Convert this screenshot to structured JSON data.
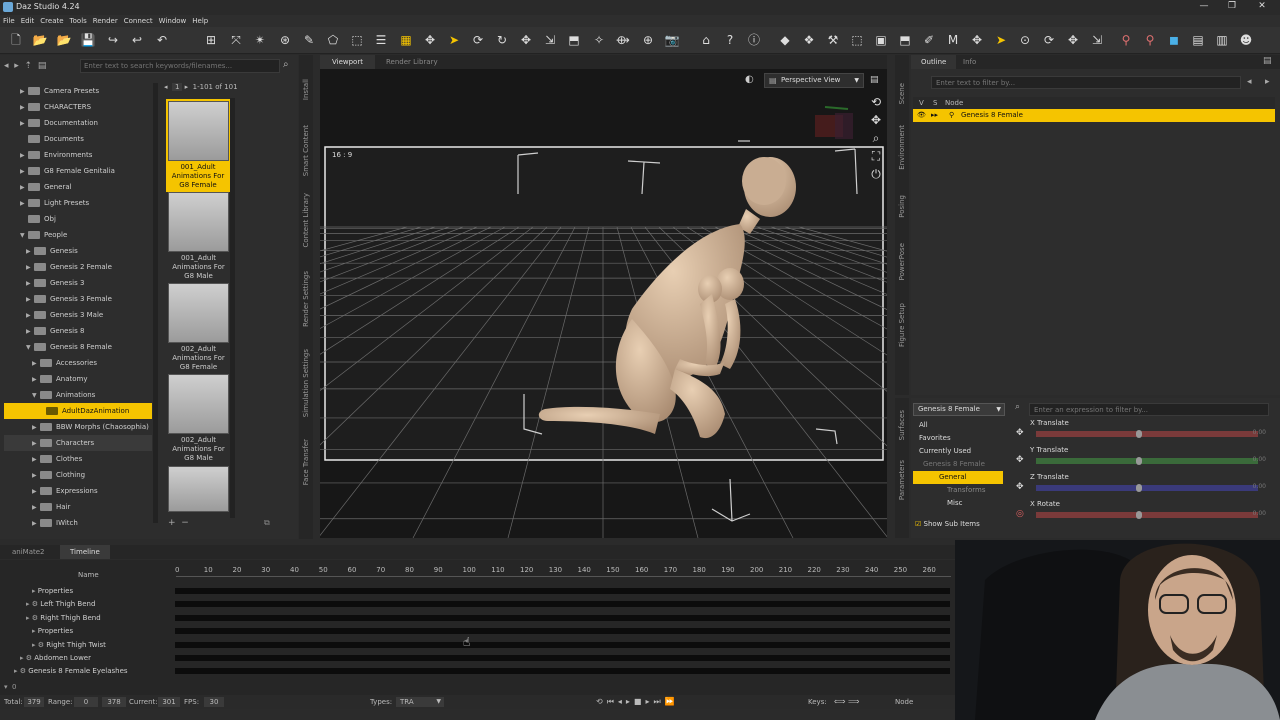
{
  "window": {
    "title": "Daz Studio 4.24",
    "controls": [
      "—",
      "❐",
      "✕"
    ]
  },
  "menu": [
    "File",
    "Edit",
    "Create",
    "Tools",
    "Render",
    "Connect",
    "Window",
    "Help"
  ],
  "content_library": {
    "search_placeholder": "Enter text to search keywords/filenames...",
    "page": "1",
    "range": "1-101 of 101",
    "tree": [
      {
        "label": "Camera Presets",
        "indent": 0,
        "state": "closed"
      },
      {
        "label": "CHARACTERS",
        "indent": 0,
        "state": "closed"
      },
      {
        "label": "Documentation",
        "indent": 0,
        "state": "closed"
      },
      {
        "label": "Documents",
        "indent": 0,
        "state": "none"
      },
      {
        "label": "Environments",
        "indent": 0,
        "state": "closed"
      },
      {
        "label": "G8 Female Genitalia",
        "indent": 0,
        "state": "closed"
      },
      {
        "label": "General",
        "indent": 0,
        "state": "closed"
      },
      {
        "label": "Light Presets",
        "indent": 0,
        "state": "closed"
      },
      {
        "label": "Obj",
        "indent": 0,
        "state": "none"
      },
      {
        "label": "People",
        "indent": 0,
        "state": "open"
      },
      {
        "label": "Genesis",
        "indent": 1,
        "state": "closed"
      },
      {
        "label": "Genesis 2 Female",
        "indent": 1,
        "state": "closed"
      },
      {
        "label": "Genesis 3",
        "indent": 1,
        "state": "closed"
      },
      {
        "label": "Genesis 3 Female",
        "indent": 1,
        "state": "closed"
      },
      {
        "label": "Genesis 3 Male",
        "indent": 1,
        "state": "closed"
      },
      {
        "label": "Genesis 8",
        "indent": 1,
        "state": "closed"
      },
      {
        "label": "Genesis 8 Female",
        "indent": 1,
        "state": "open"
      },
      {
        "label": "Accessories",
        "indent": 2,
        "state": "closed"
      },
      {
        "label": "Anatomy",
        "indent": 2,
        "state": "closed"
      },
      {
        "label": "Animations",
        "indent": 2,
        "state": "open"
      },
      {
        "label": "AdultDazAnimation",
        "indent": 3,
        "state": "none",
        "selected": true
      },
      {
        "label": "BBW Morphs (Chaosophia)",
        "indent": 2,
        "state": "closed"
      },
      {
        "label": "Characters",
        "indent": 2,
        "state": "closed",
        "hover": true
      },
      {
        "label": "Clothes",
        "indent": 2,
        "state": "closed"
      },
      {
        "label": "Clothing",
        "indent": 2,
        "state": "closed"
      },
      {
        "label": "Expressions",
        "indent": 2,
        "state": "closed"
      },
      {
        "label": "Hair",
        "indent": 2,
        "state": "closed"
      },
      {
        "label": "IWitch",
        "indent": 2,
        "state": "closed"
      }
    ],
    "thumbs": [
      {
        "caption": "001_Adult Animations For G8 Female",
        "selected": true
      },
      {
        "caption": "001_Adult Animations For G8 Male"
      },
      {
        "caption": "002_Adult Animations For G8 Female"
      },
      {
        "caption": "002_Adult Animations For G8 Male"
      },
      {
        "caption": ""
      }
    ],
    "side_tabs": [
      "Install",
      "Smart Content",
      "Content Library",
      "Render Settings",
      "Simulation Settings",
      "Face Transfer"
    ]
  },
  "viewport": {
    "tabs": [
      "Viewport",
      "Render Library"
    ],
    "view_name": "Perspective View",
    "aspect": "16 : 9"
  },
  "scene": {
    "tabs": [
      "Outline",
      "Info"
    ],
    "filter_placeholder": "Enter text to filter by...",
    "col_v": "V",
    "col_s": "S",
    "col_node": "Node",
    "node": "Genesis 8 Female",
    "side_tabs": [
      "Scene",
      "Environment",
      "Posing",
      "PowerPose",
      "Figure Setup"
    ]
  },
  "parameters": {
    "figure": "Genesis 8 Female",
    "filter_placeholder": "Enter an expression to filter by...",
    "groups": [
      "All",
      "Favorites",
      "Currently Used",
      "Genesis 8 Female",
      "General",
      "Transforms",
      "Misc"
    ],
    "show_sub_items": "Show Sub Items",
    "side_tabs": [
      "Surfaces",
      "Parameters"
    ],
    "sliders": [
      {
        "label": "X Translate",
        "value": "0.00",
        "color": "#7a3a3a"
      },
      {
        "label": "Y Translate",
        "value": "0.00",
        "color": "#3a6a3a"
      },
      {
        "label": "Z Translate",
        "value": "0.00",
        "color": "#3a3a7a"
      },
      {
        "label": "X Rotate",
        "value": "0.00",
        "color": "#7a3a3a"
      }
    ]
  },
  "timeline": {
    "tabs": [
      "aniMate2",
      "Timeline"
    ],
    "name_header": "Name",
    "ticks": [
      "0",
      "10",
      "20",
      "30",
      "40",
      "50",
      "60",
      "70",
      "80",
      "90",
      "100",
      "110",
      "120",
      "130",
      "140",
      "150",
      "160",
      "170",
      "180",
      "190",
      "200",
      "210",
      "220",
      "230",
      "240",
      "250",
      "260"
    ],
    "rows": [
      {
        "label": "Properties",
        "indent": 3
      },
      {
        "label": "Left Thigh Bend",
        "indent": 2
      },
      {
        "label": "Right Thigh Bend",
        "indent": 2
      },
      {
        "label": "Properties",
        "indent": 3
      },
      {
        "label": "Right Thigh Twist",
        "indent": 3
      },
      {
        "label": "Abdomen Lower",
        "indent": 1
      },
      {
        "label": "Genesis 8 Female Eyelashes",
        "indent": 0
      }
    ],
    "status": {
      "total_label": "Total:",
      "total": "379",
      "range_label": "Range:",
      "range_start": "0",
      "range_end": "378",
      "current_label": "Current:",
      "current": "301",
      "fps_label": "FPS:",
      "fps": "30",
      "types_label": "Types:",
      "types": "TRA",
      "keys_label": "Keys:",
      "node_label": "Node"
    }
  },
  "colors": {
    "accent": "#f5c400",
    "panel": "#2d2d2d",
    "viewport": "#161616"
  }
}
